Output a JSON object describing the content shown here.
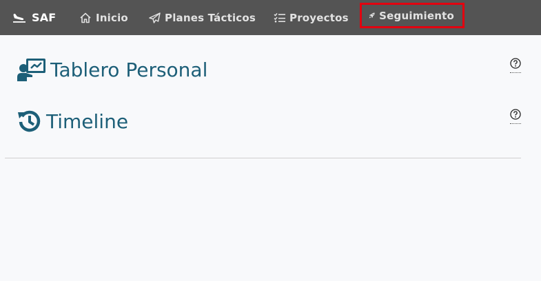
{
  "nav": {
    "brand": "SAF",
    "items": [
      {
        "label": "Inicio",
        "icon": "home-icon"
      },
      {
        "label": "Planes Tácticos",
        "icon": "paper-plane-icon"
      },
      {
        "label": "Proyectos",
        "icon": "checklist-icon"
      },
      {
        "label": "Seguimiento",
        "icon": "rocket-icon",
        "highlighted": true
      }
    ],
    "highlight_color": "#e3000f",
    "bar_color": "#545454"
  },
  "sections": [
    {
      "title": "Tablero Personal",
      "icon": "chalkboard-teacher-icon"
    },
    {
      "title": "Timeline",
      "icon": "history-icon"
    }
  ],
  "colors": {
    "heading": "#1d5f78",
    "background": "#f8f9fb"
  }
}
